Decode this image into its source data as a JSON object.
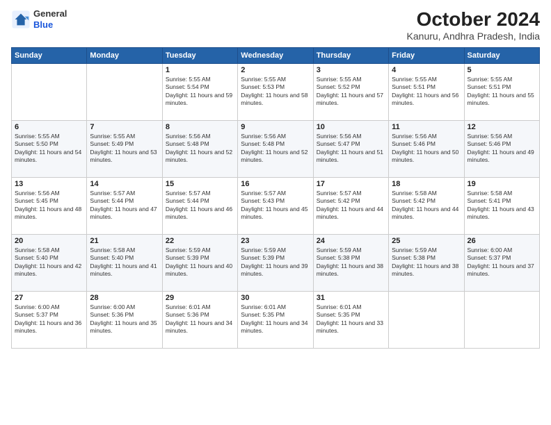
{
  "logo": {
    "general": "General",
    "blue": "Blue"
  },
  "header": {
    "title": "October 2024",
    "location": "Kanuru, Andhra Pradesh, India"
  },
  "days_of_week": [
    "Sunday",
    "Monday",
    "Tuesday",
    "Wednesday",
    "Thursday",
    "Friday",
    "Saturday"
  ],
  "weeks": [
    [
      {
        "num": "",
        "sunrise": "",
        "sunset": "",
        "daylight": ""
      },
      {
        "num": "",
        "sunrise": "",
        "sunset": "",
        "daylight": ""
      },
      {
        "num": "1",
        "sunrise": "Sunrise: 5:55 AM",
        "sunset": "Sunset: 5:54 PM",
        "daylight": "Daylight: 11 hours and 59 minutes."
      },
      {
        "num": "2",
        "sunrise": "Sunrise: 5:55 AM",
        "sunset": "Sunset: 5:53 PM",
        "daylight": "Daylight: 11 hours and 58 minutes."
      },
      {
        "num": "3",
        "sunrise": "Sunrise: 5:55 AM",
        "sunset": "Sunset: 5:52 PM",
        "daylight": "Daylight: 11 hours and 57 minutes."
      },
      {
        "num": "4",
        "sunrise": "Sunrise: 5:55 AM",
        "sunset": "Sunset: 5:51 PM",
        "daylight": "Daylight: 11 hours and 56 minutes."
      },
      {
        "num": "5",
        "sunrise": "Sunrise: 5:55 AM",
        "sunset": "Sunset: 5:51 PM",
        "daylight": "Daylight: 11 hours and 55 minutes."
      }
    ],
    [
      {
        "num": "6",
        "sunrise": "Sunrise: 5:55 AM",
        "sunset": "Sunset: 5:50 PM",
        "daylight": "Daylight: 11 hours and 54 minutes."
      },
      {
        "num": "7",
        "sunrise": "Sunrise: 5:55 AM",
        "sunset": "Sunset: 5:49 PM",
        "daylight": "Daylight: 11 hours and 53 minutes."
      },
      {
        "num": "8",
        "sunrise": "Sunrise: 5:56 AM",
        "sunset": "Sunset: 5:48 PM",
        "daylight": "Daylight: 11 hours and 52 minutes."
      },
      {
        "num": "9",
        "sunrise": "Sunrise: 5:56 AM",
        "sunset": "Sunset: 5:48 PM",
        "daylight": "Daylight: 11 hours and 52 minutes."
      },
      {
        "num": "10",
        "sunrise": "Sunrise: 5:56 AM",
        "sunset": "Sunset: 5:47 PM",
        "daylight": "Daylight: 11 hours and 51 minutes."
      },
      {
        "num": "11",
        "sunrise": "Sunrise: 5:56 AM",
        "sunset": "Sunset: 5:46 PM",
        "daylight": "Daylight: 11 hours and 50 minutes."
      },
      {
        "num": "12",
        "sunrise": "Sunrise: 5:56 AM",
        "sunset": "Sunset: 5:46 PM",
        "daylight": "Daylight: 11 hours and 49 minutes."
      }
    ],
    [
      {
        "num": "13",
        "sunrise": "Sunrise: 5:56 AM",
        "sunset": "Sunset: 5:45 PM",
        "daylight": "Daylight: 11 hours and 48 minutes."
      },
      {
        "num": "14",
        "sunrise": "Sunrise: 5:57 AM",
        "sunset": "Sunset: 5:44 PM",
        "daylight": "Daylight: 11 hours and 47 minutes."
      },
      {
        "num": "15",
        "sunrise": "Sunrise: 5:57 AM",
        "sunset": "Sunset: 5:44 PM",
        "daylight": "Daylight: 11 hours and 46 minutes."
      },
      {
        "num": "16",
        "sunrise": "Sunrise: 5:57 AM",
        "sunset": "Sunset: 5:43 PM",
        "daylight": "Daylight: 11 hours and 45 minutes."
      },
      {
        "num": "17",
        "sunrise": "Sunrise: 5:57 AM",
        "sunset": "Sunset: 5:42 PM",
        "daylight": "Daylight: 11 hours and 44 minutes."
      },
      {
        "num": "18",
        "sunrise": "Sunrise: 5:58 AM",
        "sunset": "Sunset: 5:42 PM",
        "daylight": "Daylight: 11 hours and 44 minutes."
      },
      {
        "num": "19",
        "sunrise": "Sunrise: 5:58 AM",
        "sunset": "Sunset: 5:41 PM",
        "daylight": "Daylight: 11 hours and 43 minutes."
      }
    ],
    [
      {
        "num": "20",
        "sunrise": "Sunrise: 5:58 AM",
        "sunset": "Sunset: 5:40 PM",
        "daylight": "Daylight: 11 hours and 42 minutes."
      },
      {
        "num": "21",
        "sunrise": "Sunrise: 5:58 AM",
        "sunset": "Sunset: 5:40 PM",
        "daylight": "Daylight: 11 hours and 41 minutes."
      },
      {
        "num": "22",
        "sunrise": "Sunrise: 5:59 AM",
        "sunset": "Sunset: 5:39 PM",
        "daylight": "Daylight: 11 hours and 40 minutes."
      },
      {
        "num": "23",
        "sunrise": "Sunrise: 5:59 AM",
        "sunset": "Sunset: 5:39 PM",
        "daylight": "Daylight: 11 hours and 39 minutes."
      },
      {
        "num": "24",
        "sunrise": "Sunrise: 5:59 AM",
        "sunset": "Sunset: 5:38 PM",
        "daylight": "Daylight: 11 hours and 38 minutes."
      },
      {
        "num": "25",
        "sunrise": "Sunrise: 5:59 AM",
        "sunset": "Sunset: 5:38 PM",
        "daylight": "Daylight: 11 hours and 38 minutes."
      },
      {
        "num": "26",
        "sunrise": "Sunrise: 6:00 AM",
        "sunset": "Sunset: 5:37 PM",
        "daylight": "Daylight: 11 hours and 37 minutes."
      }
    ],
    [
      {
        "num": "27",
        "sunrise": "Sunrise: 6:00 AM",
        "sunset": "Sunset: 5:37 PM",
        "daylight": "Daylight: 11 hours and 36 minutes."
      },
      {
        "num": "28",
        "sunrise": "Sunrise: 6:00 AM",
        "sunset": "Sunset: 5:36 PM",
        "daylight": "Daylight: 11 hours and 35 minutes."
      },
      {
        "num": "29",
        "sunrise": "Sunrise: 6:01 AM",
        "sunset": "Sunset: 5:36 PM",
        "daylight": "Daylight: 11 hours and 34 minutes."
      },
      {
        "num": "30",
        "sunrise": "Sunrise: 6:01 AM",
        "sunset": "Sunset: 5:35 PM",
        "daylight": "Daylight: 11 hours and 34 minutes."
      },
      {
        "num": "31",
        "sunrise": "Sunrise: 6:01 AM",
        "sunset": "Sunset: 5:35 PM",
        "daylight": "Daylight: 11 hours and 33 minutes."
      },
      {
        "num": "",
        "sunrise": "",
        "sunset": "",
        "daylight": ""
      },
      {
        "num": "",
        "sunrise": "",
        "sunset": "",
        "daylight": ""
      }
    ]
  ]
}
